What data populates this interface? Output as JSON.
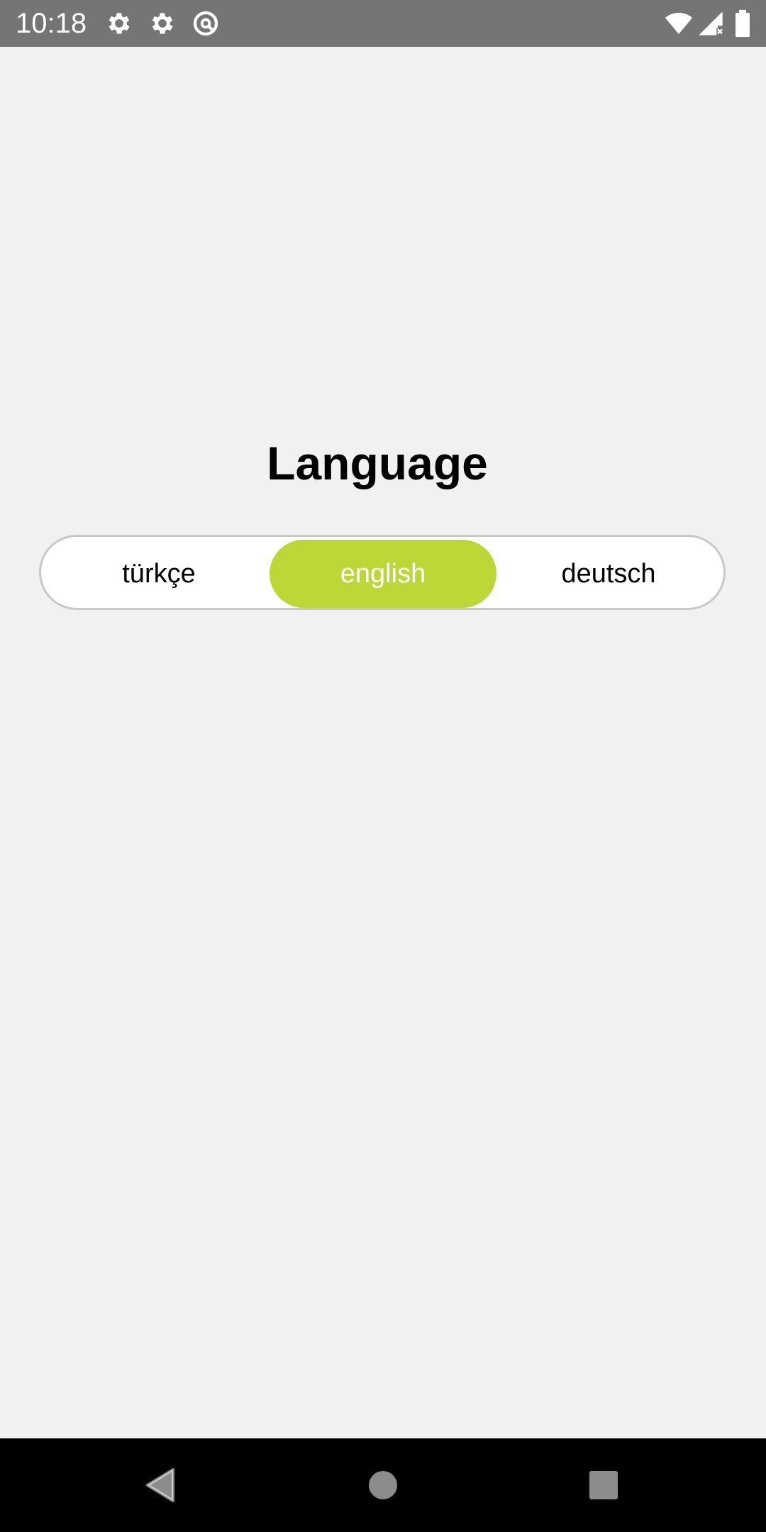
{
  "status_bar": {
    "time": "10:18",
    "left_icons": [
      "gear-icon",
      "gear-icon",
      "vpn-lock-icon"
    ],
    "right_icons": [
      "wifi-icon",
      "signal-icon",
      "battery-icon"
    ],
    "background": "#757575"
  },
  "main": {
    "title": "Language",
    "language_selector": {
      "options": [
        {
          "label": "türkçe",
          "selected": false
        },
        {
          "label": "english",
          "selected": true
        },
        {
          "label": "deutsch",
          "selected": false
        }
      ],
      "selected_color": "#bdd736"
    }
  },
  "nav_bar": {
    "buttons": [
      "back-icon",
      "home-icon",
      "recents-icon"
    ]
  }
}
